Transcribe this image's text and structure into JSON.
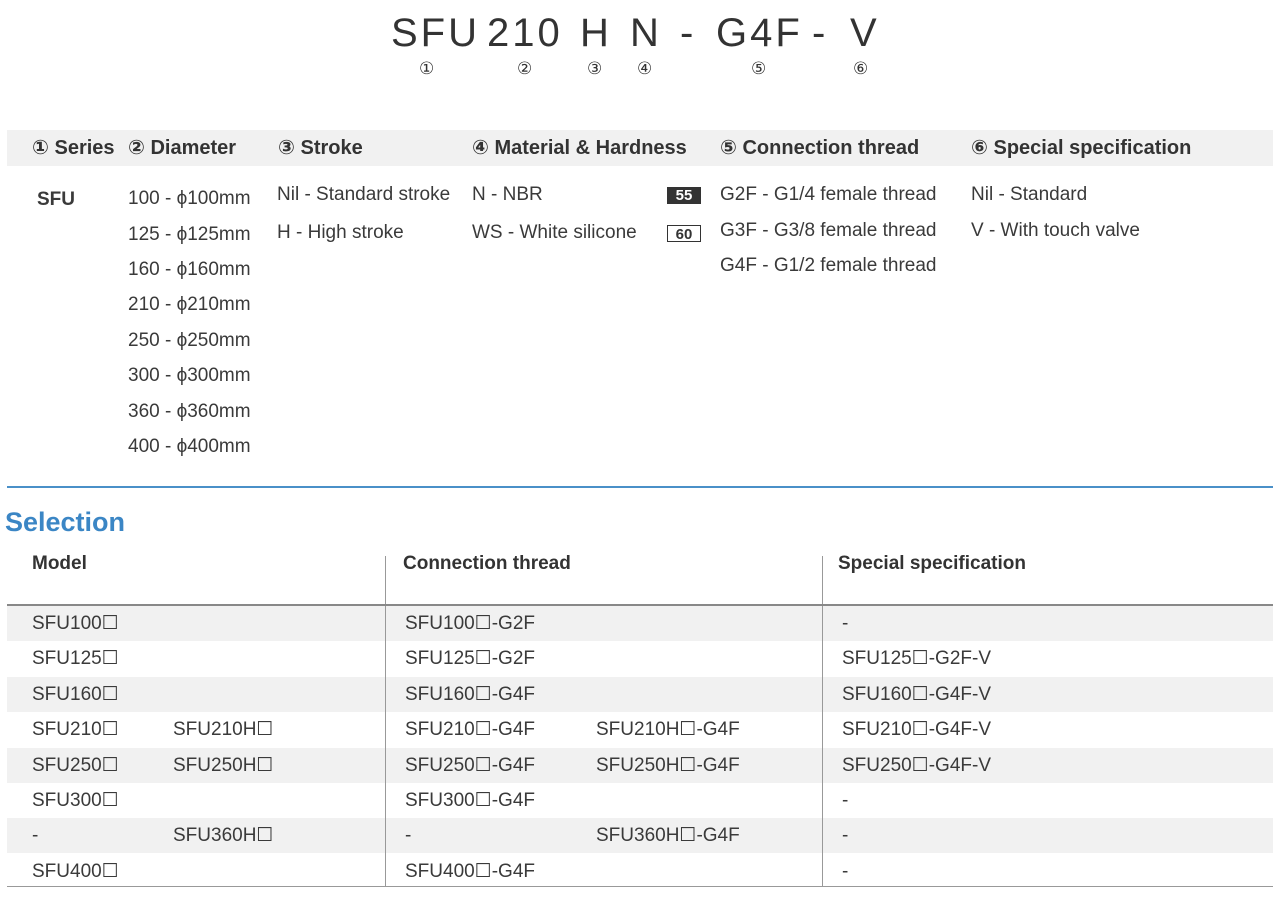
{
  "model_code": {
    "parts": [
      "SFU",
      "210",
      "H",
      "N",
      "-",
      "G4F",
      "-",
      "V"
    ],
    "numbers": [
      "①",
      "②",
      "③",
      "④",
      "⑤",
      "⑥"
    ]
  },
  "ordering": {
    "headers": [
      "① Series",
      "② Diameter",
      "③ Stroke",
      "④ Material & Hardness",
      "⑤ Connection thread",
      "⑥ Special specification"
    ],
    "series": "SFU",
    "diameters": [
      "100 - ϕ100mm",
      "125 - ϕ125mm",
      "160 - ϕ160mm",
      "210 - ϕ210mm",
      "250 - ϕ250mm",
      "300 - ϕ300mm",
      "360 - ϕ360mm",
      "400 - ϕ400mm"
    ],
    "strokes": [
      "Nil - Standard stroke",
      "H  -  High stroke"
    ],
    "materials": [
      {
        "label": "N   - NBR",
        "hardness": "55"
      },
      {
        "label": "WS - White silicone",
        "hardness": "60"
      }
    ],
    "threads": [
      "G2F  - G1/4  female thread",
      "G3F  - G3/8  female thread",
      "G4F  - G1/2  female thread"
    ],
    "specials": [
      "Nil - Standard",
      "V   - With touch valve"
    ]
  },
  "selection": {
    "title": "Selection",
    "headers": [
      "Model",
      "Connection thread",
      "Special specification"
    ],
    "rows": [
      [
        "SFU100☐",
        "",
        "SFU100☐-G2F",
        "",
        "-"
      ],
      [
        "SFU125☐",
        "",
        "SFU125☐-G2F",
        "",
        "SFU125☐-G2F-V"
      ],
      [
        "SFU160☐",
        "",
        "SFU160☐-G4F",
        "",
        "SFU160☐-G4F-V"
      ],
      [
        "SFU210☐",
        "SFU210H☐",
        "SFU210☐-G4F",
        "SFU210H☐-G4F",
        "SFU210☐-G4F-V"
      ],
      [
        "SFU250☐",
        "SFU250H☐",
        "SFU250☐-G4F",
        "SFU250H☐-G4F",
        "SFU250☐-G4F-V"
      ],
      [
        "SFU300☐",
        "",
        "SFU300☐-G4F",
        "",
        "-"
      ],
      [
        "-",
        "SFU360H☐",
        "-",
        "SFU360H☐-G4F",
        "-"
      ],
      [
        "SFU400☐",
        "",
        "SFU400☐-G4F",
        "",
        "-"
      ]
    ]
  }
}
